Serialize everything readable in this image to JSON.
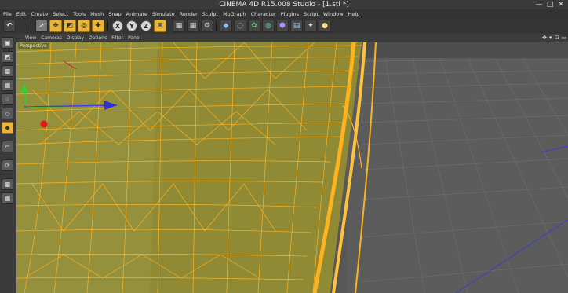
{
  "window": {
    "title": "CINEMA 4D R15.008 Studio - [1.stl *]",
    "minimize_glyph": "—",
    "maximize_glyph": "□",
    "close_glyph": "✕"
  },
  "menubar": {
    "items": [
      "File",
      "Edit",
      "Create",
      "Select",
      "Tools",
      "Mesh",
      "Snap",
      "Animate",
      "Simulate",
      "Render",
      "Sculpt",
      "MoGraph",
      "Character",
      "Plugins",
      "Script",
      "Window",
      "Help"
    ]
  },
  "toolbar": {
    "axis_x": "X",
    "axis_y": "Y",
    "axis_z": "Z",
    "icons": [
      "undo-icon",
      "live-selection-icon",
      "move-icon",
      "scale-icon",
      "rotate-icon",
      "recent-tool-icon",
      "lock-x-icon",
      "lock-y-icon",
      "lock-z-icon",
      "coordinate-system-icon",
      "render-view-icon",
      "render-picture-viewer-icon",
      "edit-render-settings-icon",
      "cube-primitive-icon",
      "subdivision-icon",
      "array-icon",
      "deformer-icon",
      "scene-icon",
      "camera-icon",
      "light-icon"
    ]
  },
  "lefttoolbar": {
    "icons": [
      "make-editable-icon",
      "model-mode-icon",
      "texture-mode-icon",
      "workplane-mode-icon",
      "points-mode-icon",
      "edges-mode-icon",
      "polygons-mode-icon",
      "axis-mode-icon",
      "tweak-mode-icon",
      "snapping-icon",
      "workplane-lock-icon"
    ]
  },
  "viewport": {
    "menu": [
      "View",
      "Cameras",
      "Display",
      "Options",
      "Filter",
      "Panel"
    ],
    "label": "Perspective",
    "controls": [
      "✥",
      "▾",
      "⊡",
      "▭"
    ],
    "colors": {
      "mesh_fill": "#8f8a33",
      "wire": "#ffb21f",
      "floor": "#6a6a6a",
      "grid": "#7a7a7a"
    }
  }
}
